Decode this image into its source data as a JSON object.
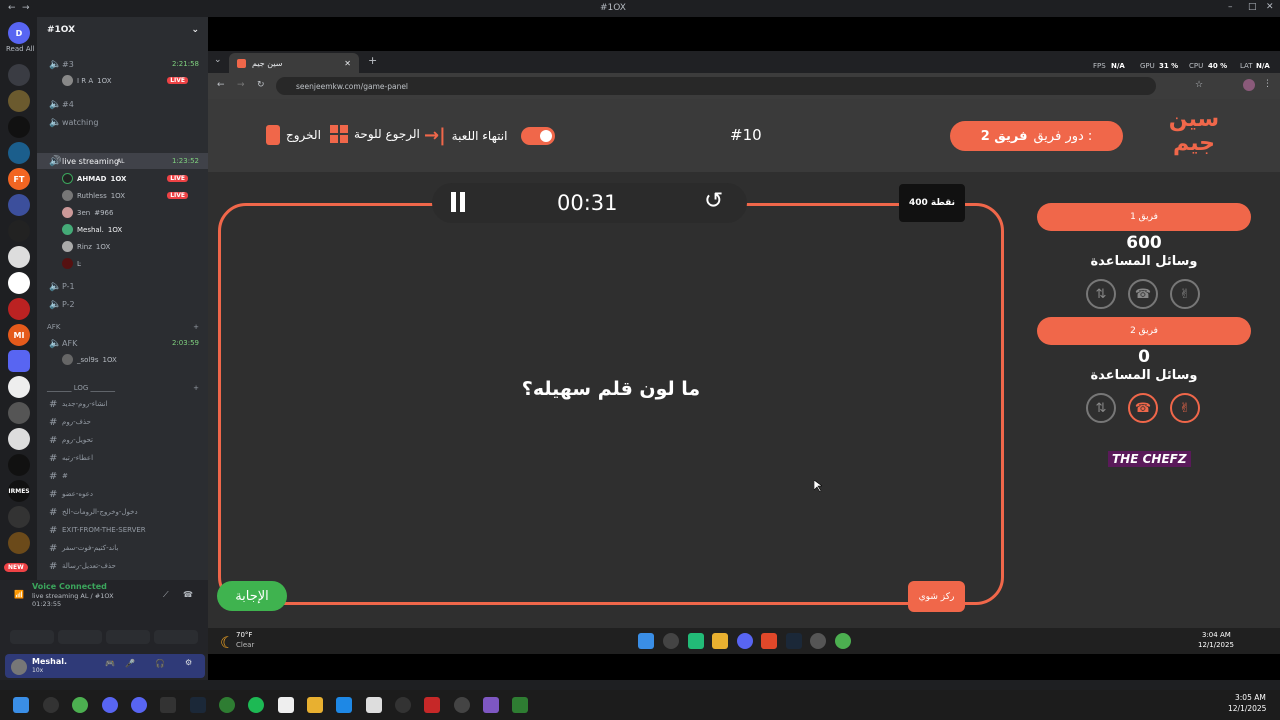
{
  "window": {
    "title": "#1OX"
  },
  "rail": {
    "read_all": "Read All",
    "badge": "2",
    "new": "NEW"
  },
  "server": {
    "name": "#1OX"
  },
  "channels": {
    "c3": {
      "name": "#3",
      "time": "2:21:58",
      "user": "I R A",
      "tag": "1OX",
      "live": "LIVE"
    },
    "c4": {
      "name": "#4"
    },
    "watching": {
      "name": "watching"
    },
    "live": {
      "name": "live streaming",
      "tag": "AL",
      "time": "1:23:52"
    },
    "users": [
      {
        "name": "AHMAD",
        "tag": "1OX",
        "live": "LIVE"
      },
      {
        "name": "Ruthless",
        "tag": "1OX",
        "live": "LIVE"
      },
      {
        "name": "3en",
        "tag": "#966"
      },
      {
        "name": "Meshal.",
        "tag": "1OX"
      },
      {
        "name": "Rinz",
        "tag": "1OX"
      },
      {
        "name": "Ŀ"
      }
    ],
    "p1": "P-1",
    "p2": "P-2",
    "afk_cat": "AFK",
    "afk": {
      "name": "AFK",
      "time": "2:03:59",
      "user": "_sol9s",
      "tag": "1OX"
    },
    "log_cat": "_______ LOG _______",
    "text": [
      "انشاء-روم-جديد",
      "حذف-روم",
      "تحويل-روم",
      "اعطاء-رتبه",
      "#",
      "دعوه-عضو",
      "دخول-وخروج-الرومات-الخ",
      "EXIT-FROM-THE-SERVER",
      "باند-كتيم-فوت-سفر",
      "حذف-تعديل-رسالة"
    ]
  },
  "voice": {
    "status": "Voice Connected",
    "channel": "live streaming AL / #1OX",
    "time": "01:23:55",
    "user": "Meshal.",
    "user_sub": "10x"
  },
  "browser": {
    "tab": "سين جيم",
    "url": "seenjeemkw.com/game-panel",
    "fps_label": "FPS",
    "fps": "N/A",
    "gpu_label": "GPU",
    "gpu": "31 %",
    "cpu_label": "CPU",
    "cpu": "40 %",
    "lat_label": "LAT",
    "lat": "N/A"
  },
  "game": {
    "logo": "سين جيم",
    "turn_label": "دور فريق :",
    "turn_team": "فريق 2",
    "question_no": "#10",
    "end_game": "انتهاء اللعبة",
    "back_board": "الرجوع للوحة",
    "exit": "الخروج",
    "timer": "00:31",
    "points": "400 نقطة",
    "question": "ما لون قلم سهيله؟",
    "answer_btn": "الإجابة",
    "category": "ركز شوي",
    "team1": {
      "name": "فريق 1",
      "score": "600",
      "helpers": "وسائل المساعدة"
    },
    "team2": {
      "name": "فريق 2",
      "score": "0",
      "helpers": "وسائل المساعدة"
    },
    "sponsor": "THE CHEFZ"
  },
  "taskbar_inner": {
    "weather_temp": "70°F",
    "weather": "Clear",
    "time": "3:04 AM",
    "date": "12/1/2025"
  },
  "taskbar": {
    "time": "3:05 AM",
    "date": "12/1/2025"
  },
  "colors": {
    "accent": "#f0674a",
    "green": "#3fb34f",
    "bg": "#2f2f2f"
  }
}
